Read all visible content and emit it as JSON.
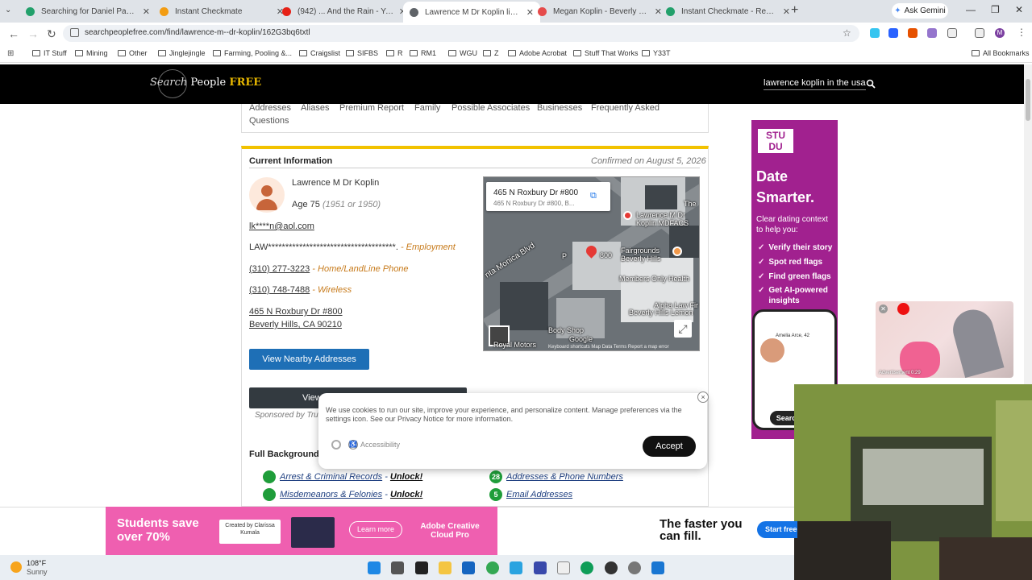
{
  "browser": {
    "tabs": [
      {
        "label": "Searching for Daniel Panzer in",
        "favicon_color": "#22a06b",
        "active": false
      },
      {
        "label": "Instant Checkmate",
        "favicon_color": "#f29c12",
        "active": false
      },
      {
        "label": "(942) ... And the Rain - YouTube",
        "favicon_color": "#e62117",
        "active": false
      },
      {
        "label": "Lawrence M Dr Koplin living in",
        "favicon_color": "#5f6368",
        "active": true
      },
      {
        "label": "Megan Koplin - Beverly Hills, CA",
        "favicon_color": "#e54b4b",
        "active": false
      },
      {
        "label": "Instant Checkmate - Report",
        "favicon_color": "#22a06b",
        "active": false
      }
    ],
    "new_tab": "+",
    "gemini": "Ask Gemini",
    "url": "searchpeoplefree.com/find/lawrence-m--dr-koplin/162G3bq6txtl",
    "bookmarks": [
      "IT Stuff",
      "Mining",
      "Other",
      "Jinglejingle",
      "Farming, Pooling &...",
      "Craigslist",
      "SIFBS",
      "R",
      "RM1",
      "WGU",
      "Z",
      "Adobe Acrobat",
      "Stuff That Works",
      "Y33T"
    ],
    "all_bookmarks": "All Bookmarks"
  },
  "site": {
    "logo_part1": "Search",
    "logo_part2": " People ",
    "logo_part3": "FREE",
    "search_query": "lawrence koplin in the usa"
  },
  "nav": {
    "links": [
      "Addresses",
      "Aliases",
      "Premium Report",
      "Family",
      "Possible Associates",
      "Businesses",
      "Frequently Asked"
    ],
    "links_row2": [
      "Questions"
    ]
  },
  "info": {
    "title": "Current Information",
    "confirmed": "Confirmed on August 5, 2026",
    "name": "Lawrence M Dr Koplin",
    "age": "Age 75",
    "birth": "(1951 or 1950)",
    "email": "lk****n@aol.com",
    "employment": "LAW*************************************.",
    "employment_tag": "- Employment",
    "phone1": "(310) 277-3223",
    "phone1_tag": "- Home/LandLine Phone",
    "phone2": "(310) 748-7488",
    "phone2_tag": "- Wireless",
    "address_line1": "465 N Roxbury Dr #800",
    "address_line2": "Beverly Hills, CA 90210",
    "nearby_button": "View Nearby Addresses",
    "view_button": "View",
    "sponsored": "Sponsored by Tru"
  },
  "map": {
    "card_title": "465 N Roxbury Dr #800",
    "card_sub": "465 N Roxbury Dr #800, B...",
    "labels": [
      "Lawrence M Dr Koplin MDFACS",
      "Fairgrounds Beverly Hills",
      "Members Only Health",
      "Alpha Law Fir",
      "Beverly Hills Lemon",
      "nta Monica Blvd",
      "Body Shop",
      "800",
      "The",
      "P"
    ],
    "footer": "Keyboard shortcuts   Map Data   Terms   Report a map error",
    "google": "Google",
    "royal": "Royal Motors"
  },
  "report": {
    "heading": "Full Background",
    "left_items": [
      {
        "label": "Arrest & Criminal Records",
        "action": "Unlock!"
      },
      {
        "label": "Misdemeanors & Felonies",
        "action": "Unlock!"
      }
    ],
    "right_items": [
      {
        "count": "28",
        "label": "Addresses & Phone Numbers"
      },
      {
        "count": "5",
        "label": "Email Addresses"
      }
    ]
  },
  "cookie": {
    "text": "We use cookies to run our site, improve your experience, and personalize content. Manage preferences via the settings icon. See our Privacy Notice for more information.",
    "accessibility": "Accessibility",
    "accept": "Accept",
    "close": "×"
  },
  "side_ad": {
    "logo": "STU DU",
    "title": "Date Smarter.",
    "subtitle": "Clear dating context to help you:",
    "bullets": [
      "Verify their story",
      "Spot red flags",
      "Find green flags",
      "Get AI-powered insights"
    ],
    "phone_name": "Amelia Arce, 42",
    "search": "Searc"
  },
  "video": {
    "caption": "Advertisement 0:29"
  },
  "bottom_ad": {
    "headline": "Students save over 70%",
    "creator": "Created by Clarissa Kumala",
    "learn_more": "Learn more",
    "product": "Adobe Creative Cloud Pro",
    "faster": "The faster you can fill.",
    "start_free": "Start free"
  },
  "taskbar": {
    "temp": "108°F",
    "condition": "Sunny"
  }
}
